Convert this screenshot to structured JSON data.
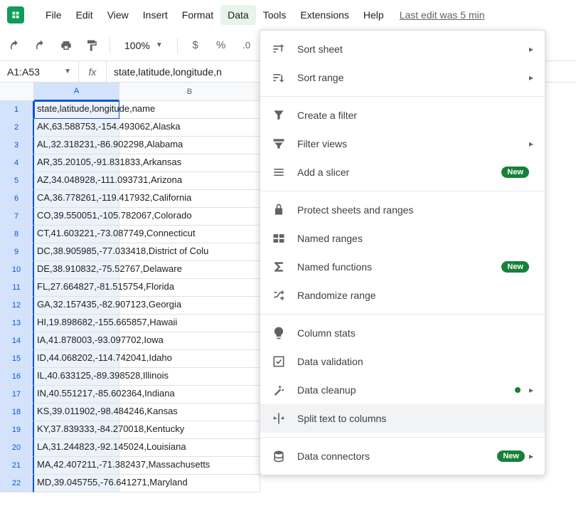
{
  "menubar": {
    "items": [
      "File",
      "Edit",
      "View",
      "Insert",
      "Format",
      "Data",
      "Tools",
      "Extensions",
      "Help"
    ],
    "active_index": 5,
    "last_edit": "Last edit was 5 min"
  },
  "toolbar": {
    "zoom": "100%",
    "currency": "$",
    "percent": "%",
    "decimals": ".0"
  },
  "formula_bar": {
    "cell_ref": "A1:A53",
    "formula_text": "state,latitude,longitude,n"
  },
  "columns": [
    {
      "letter": "A",
      "width": 120,
      "selected": true
    },
    {
      "letter": "B",
      "width": 198,
      "selected": false
    }
  ],
  "rows": [
    {
      "n": 1,
      "a": "state,latitude,longitude,name"
    },
    {
      "n": 2,
      "a": "AK,63.588753,-154.493062,Alaska"
    },
    {
      "n": 3,
      "a": "AL,32.318231,-86.902298,Alabama"
    },
    {
      "n": 4,
      "a": "AR,35.20105,-91.831833,Arkansas"
    },
    {
      "n": 5,
      "a": "AZ,34.048928,-111.093731,Arizona"
    },
    {
      "n": 6,
      "a": "CA,36.778261,-119.417932,California"
    },
    {
      "n": 7,
      "a": "CO,39.550051,-105.782067,Colorado"
    },
    {
      "n": 8,
      "a": "CT,41.603221,-73.087749,Connecticut"
    },
    {
      "n": 9,
      "a": "DC,38.905985,-77.033418,District of Colu"
    },
    {
      "n": 10,
      "a": "DE,38.910832,-75.52767,Delaware"
    },
    {
      "n": 11,
      "a": "FL,27.664827,-81.515754,Florida"
    },
    {
      "n": 12,
      "a": "GA,32.157435,-82.907123,Georgia"
    },
    {
      "n": 13,
      "a": "HI,19.898682,-155.665857,Hawaii"
    },
    {
      "n": 14,
      "a": "IA,41.878003,-93.097702,Iowa"
    },
    {
      "n": 15,
      "a": "ID,44.068202,-114.742041,Idaho"
    },
    {
      "n": 16,
      "a": "IL,40.633125,-89.398528,Illinois"
    },
    {
      "n": 17,
      "a": "IN,40.551217,-85.602364,Indiana"
    },
    {
      "n": 18,
      "a": "KS,39.011902,-98.484246,Kansas"
    },
    {
      "n": 19,
      "a": "KY,37.839333,-84.270018,Kentucky"
    },
    {
      "n": 20,
      "a": "LA,31.244823,-92.145024,Louisiana"
    },
    {
      "n": 21,
      "a": "MA,42.407211,-71.382437,Massachusetts"
    },
    {
      "n": 22,
      "a": "MD,39.045755,-76.641271,Maryland"
    }
  ],
  "dropdown": {
    "groups": [
      [
        {
          "icon": "sort-sheet",
          "label": "Sort sheet",
          "arrow": true
        },
        {
          "icon": "sort-range",
          "label": "Sort range",
          "arrow": true
        }
      ],
      [
        {
          "icon": "filter",
          "label": "Create a filter"
        },
        {
          "icon": "filter-views",
          "label": "Filter views",
          "arrow": true
        },
        {
          "icon": "slicer",
          "label": "Add a slicer",
          "badge": "New"
        }
      ],
      [
        {
          "icon": "lock",
          "label": "Protect sheets and ranges"
        },
        {
          "icon": "named-ranges",
          "label": "Named ranges"
        },
        {
          "icon": "sigma",
          "label": "Named functions",
          "badge": "New"
        },
        {
          "icon": "shuffle",
          "label": "Randomize range"
        }
      ],
      [
        {
          "icon": "bulb",
          "label": "Column stats"
        },
        {
          "icon": "check-circle",
          "label": "Data validation"
        },
        {
          "icon": "wand",
          "label": "Data cleanup",
          "dot": true,
          "arrow": true
        },
        {
          "icon": "split",
          "label": "Split text to columns",
          "hover": true
        }
      ],
      [
        {
          "icon": "database",
          "label": "Data connectors",
          "badge": "New",
          "arrow": true
        }
      ]
    ]
  }
}
